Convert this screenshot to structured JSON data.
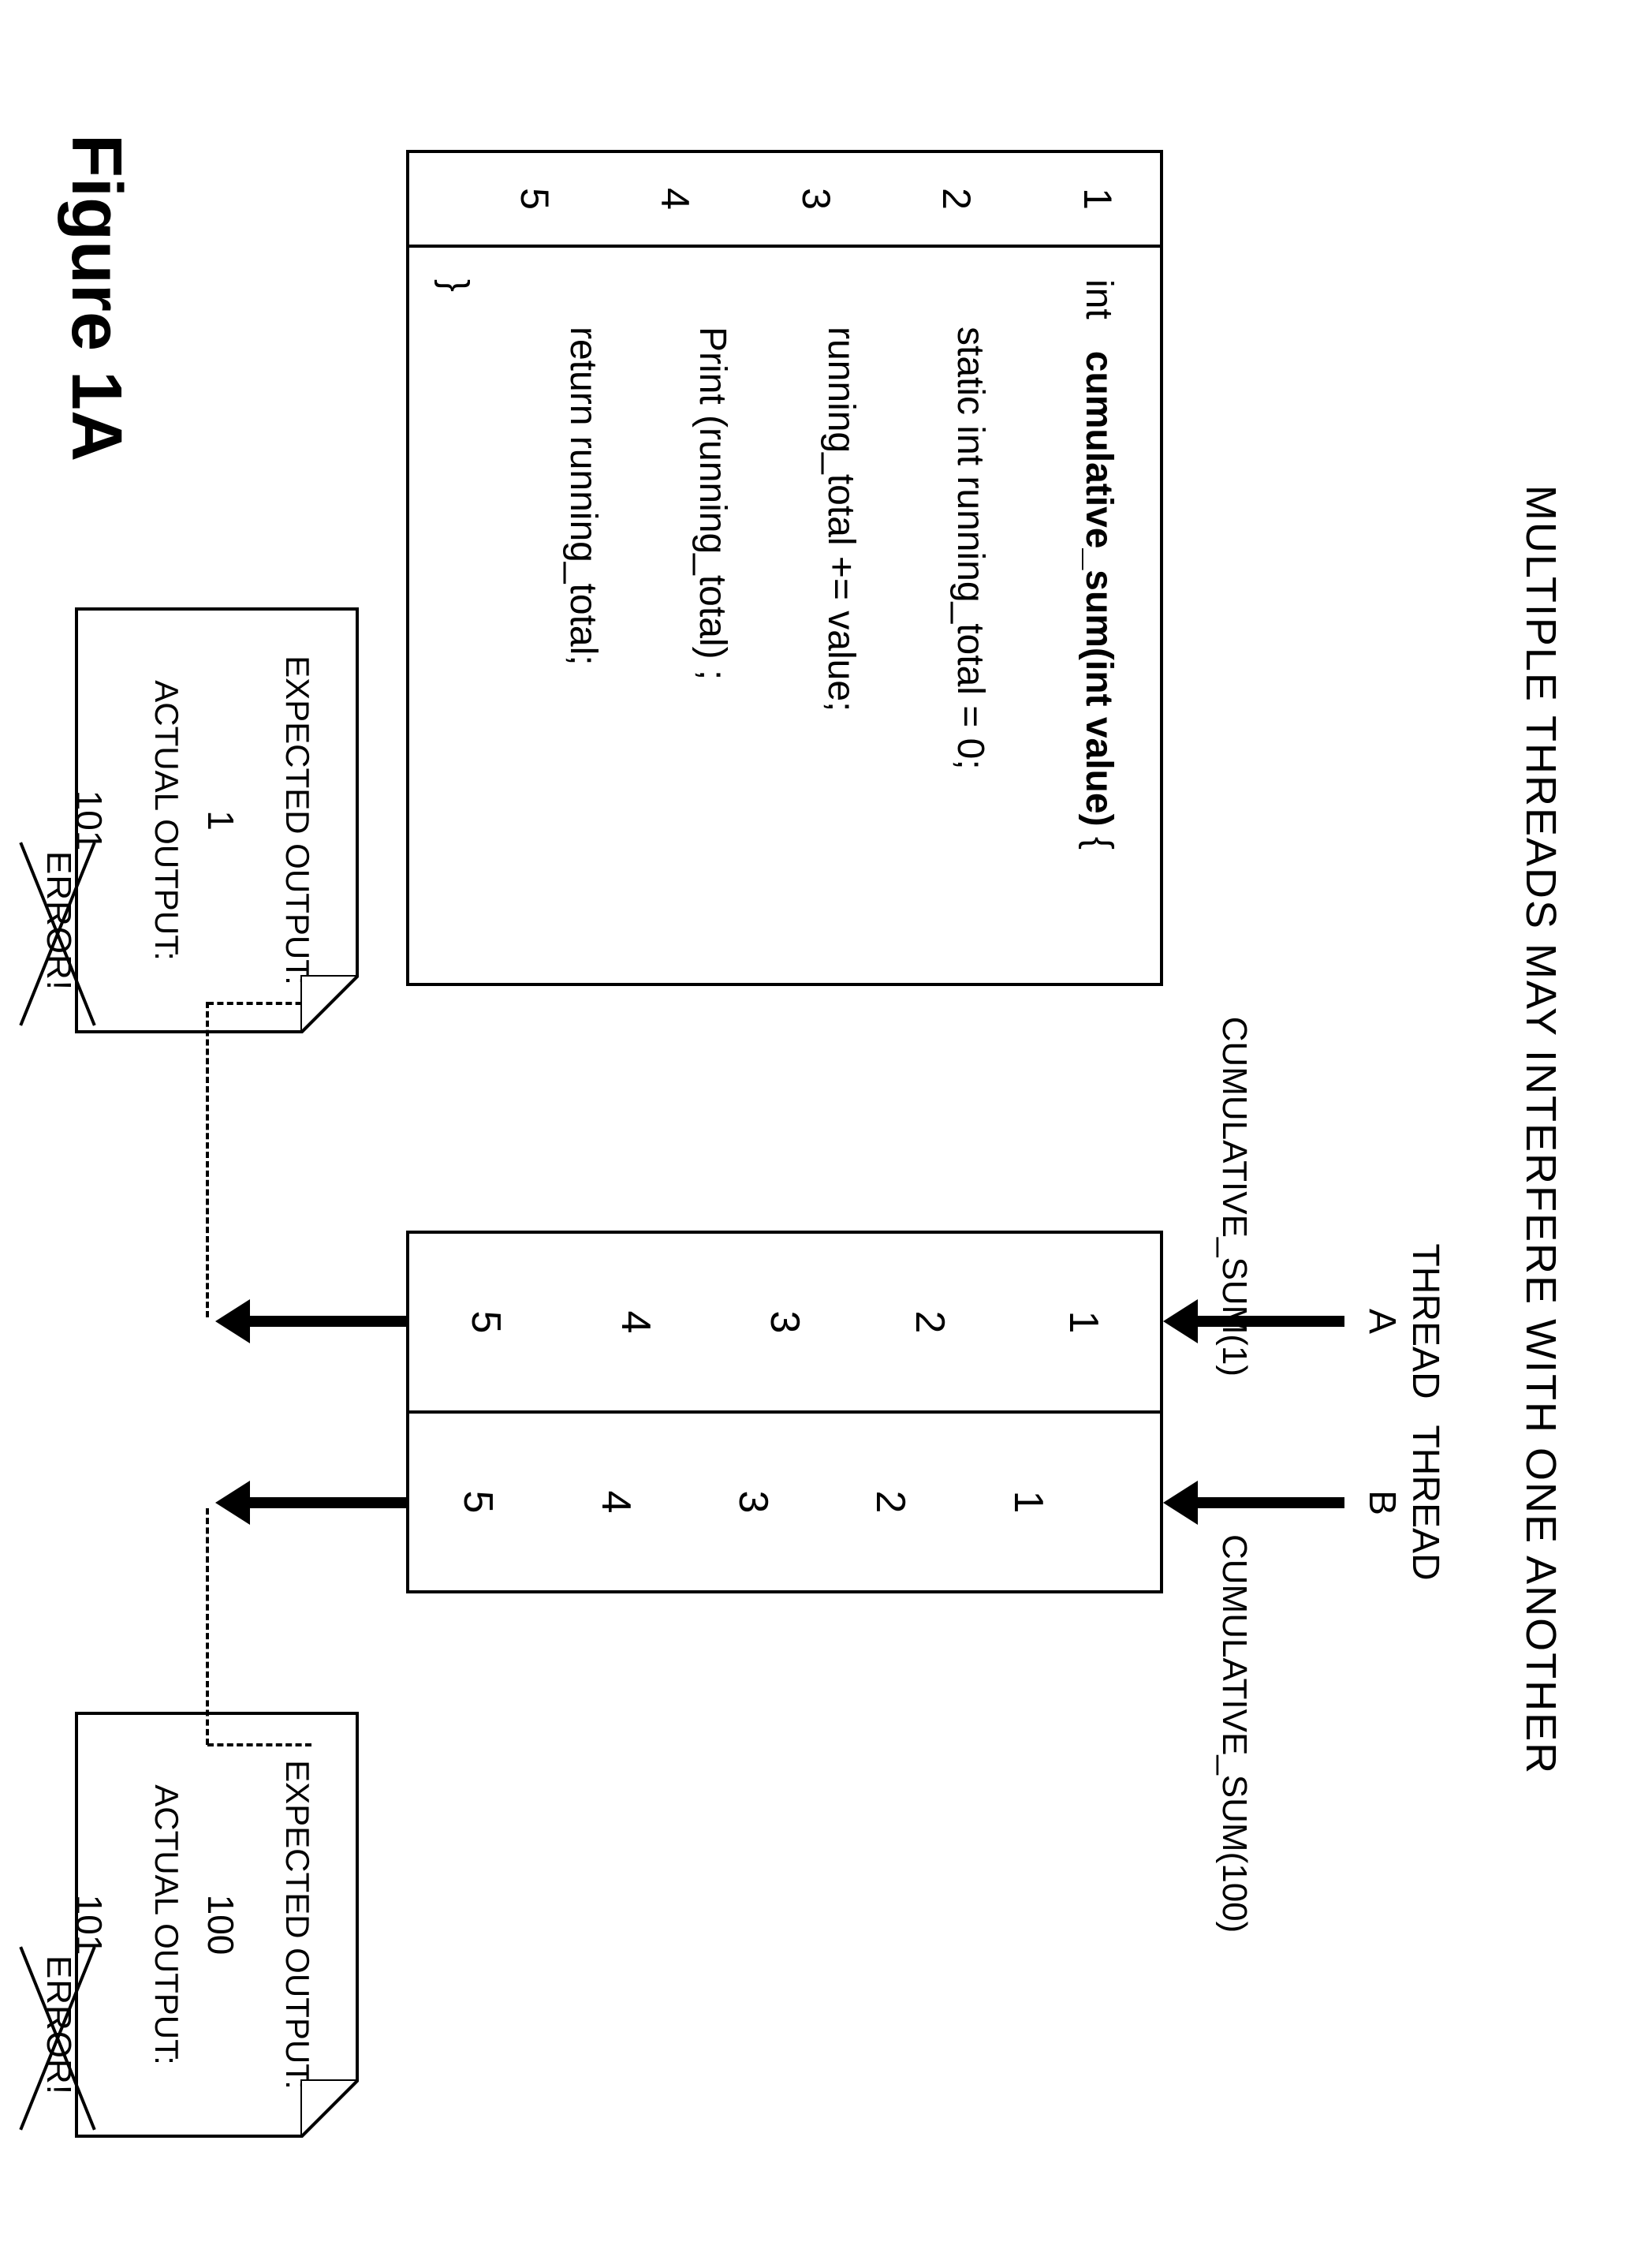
{
  "title": "MULTIPLE THREADS MAY INTERFERE WITH ONE ANOTHER",
  "figure_label": "Figure 1A",
  "code": {
    "line_nums": [
      "1",
      "2",
      "3",
      "4",
      "5"
    ],
    "ret_type": "int",
    "fn_sig": "cumulative_sum(int value)",
    "brace_open": "  {",
    "lines": [
      "static int running_total = 0;",
      "running_total += value;",
      "Print (running_total) ;",
      "return running_total;"
    ],
    "brace_close": "}"
  },
  "threads": {
    "a_label": "THREAD\nA",
    "b_label": "THREAD\nB",
    "a_call": "CUMULATIVE_SUM(1)",
    "b_call": "CUMULATIVE_SUM(100)",
    "col_a": [
      "1",
      "2",
      "3",
      "4",
      "5"
    ],
    "col_b": [
      "1",
      "2",
      "3",
      "4",
      "5"
    ]
  },
  "note_a": {
    "expected_label": "EXPECTED OUTPUT:",
    "expected_val": "1",
    "actual_label": "ACTUAL OUTPUT:",
    "actual_val": "101",
    "error": "ERROR!"
  },
  "note_b": {
    "expected_label": "EXPECTED OUTPUT:",
    "expected_val": "100",
    "actual_label": "ACTUAL OUTPUT:",
    "actual_val": "101",
    "error": "ERROR!"
  }
}
